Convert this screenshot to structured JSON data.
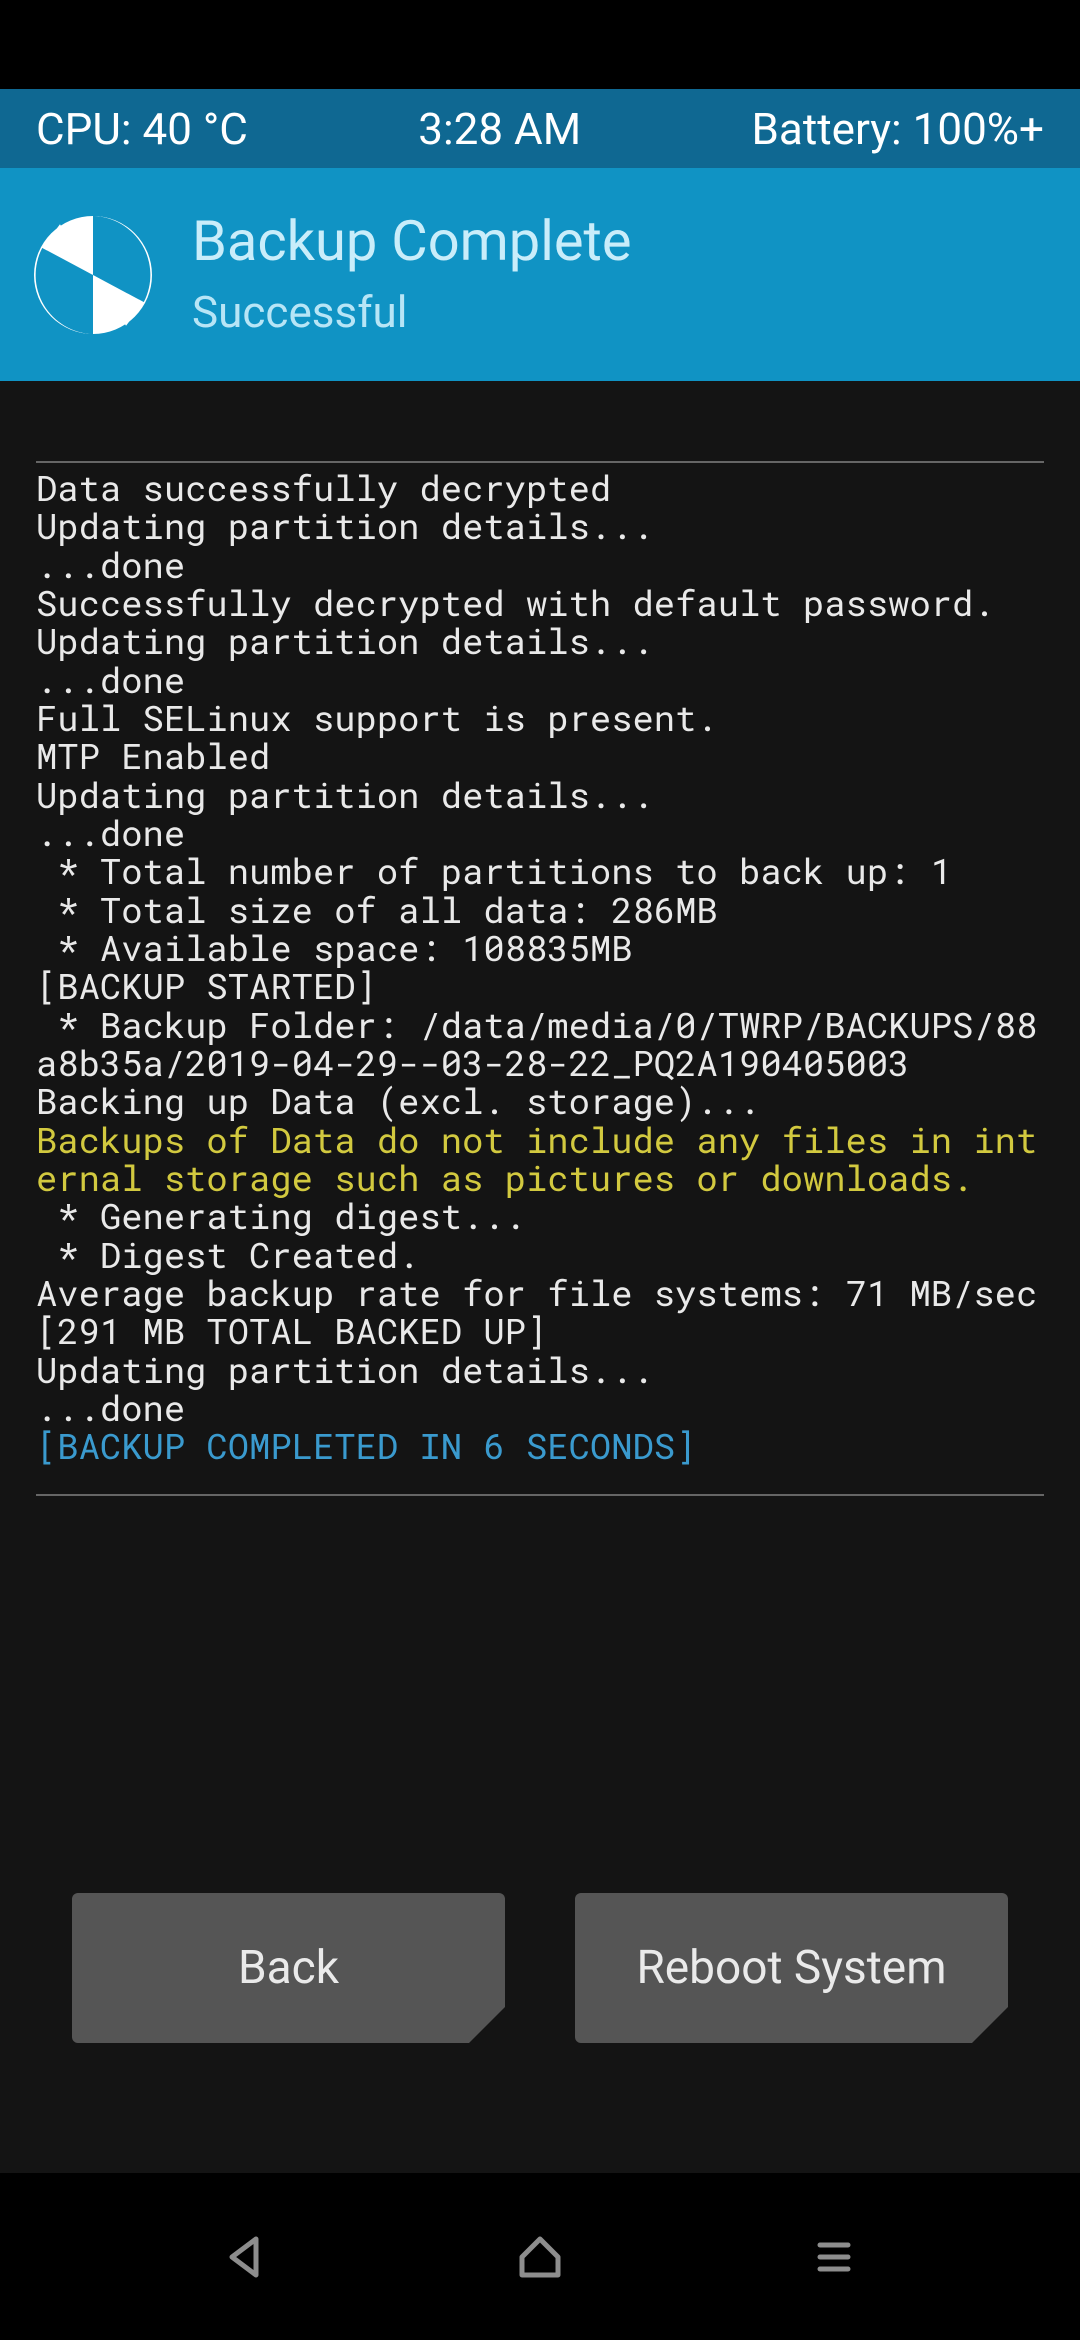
{
  "status": {
    "cpu": "CPU: 40 °C",
    "time": "3:28 AM",
    "battery": "Battery: 100%+"
  },
  "header": {
    "title": "Backup Complete",
    "subtitle": "Successful"
  },
  "log": {
    "lines": [
      {
        "t": "Data successfully decrypted"
      },
      {
        "t": "Updating partition details..."
      },
      {
        "t": "...done"
      },
      {
        "t": "Successfully decrypted with default password."
      },
      {
        "t": "Updating partition details..."
      },
      {
        "t": "...done"
      },
      {
        "t": "Full SELinux support is present."
      },
      {
        "t": "MTP Enabled"
      },
      {
        "t": "Updating partition details..."
      },
      {
        "t": "...done"
      },
      {
        "t": " * Total number of partitions to back up: 1"
      },
      {
        "t": " * Total size of all data: 286MB"
      },
      {
        "t": " * Available space: 108835MB"
      },
      {
        "t": "[BACKUP STARTED]"
      },
      {
        "t": " * Backup Folder: /data/media/0/TWRP/BACKUPS/88a8b35a/2019-04-29--03-28-22_PQ2A190405003"
      },
      {
        "t": "Backing up Data (excl. storage)..."
      },
      {
        "t": "Backups of Data do not include any files in internal storage such as pictures or downloads.",
        "c": "yellow"
      },
      {
        "t": " * Generating digest..."
      },
      {
        "t": " * Digest Created."
      },
      {
        "t": "Average backup rate for file systems: 71 MB/sec"
      },
      {
        "t": "[291 MB TOTAL BACKED UP]"
      },
      {
        "t": "Updating partition details..."
      },
      {
        "t": "...done"
      },
      {
        "t": "[BACKUP COMPLETED IN 6 SECONDS]",
        "c": "blue"
      }
    ]
  },
  "buttons": {
    "back": "Back",
    "reboot": "Reboot System"
  },
  "colors": {
    "accent": "#1093c4",
    "statusbar": "#0f6892",
    "button": "#555555"
  }
}
